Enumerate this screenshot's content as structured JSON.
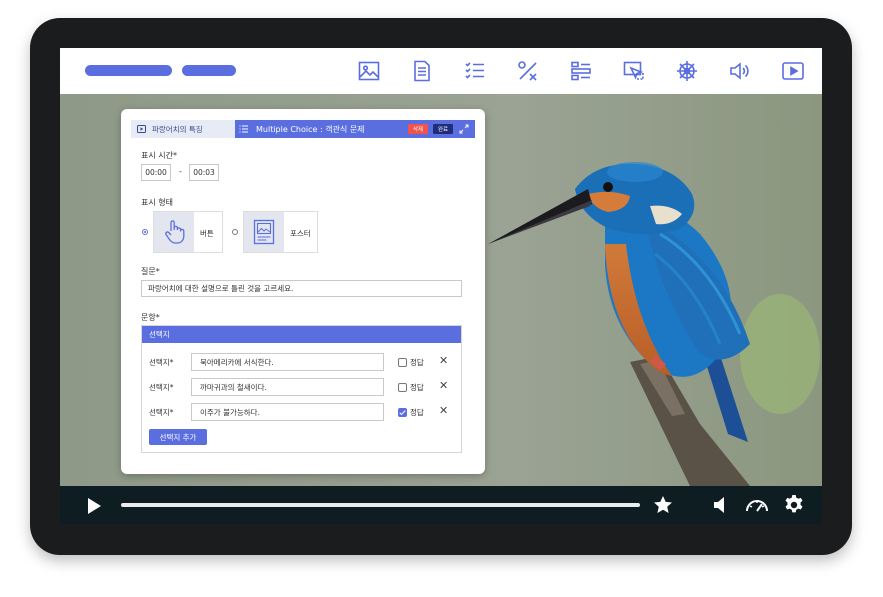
{
  "toolbar": {
    "icons": [
      "image-icon",
      "document-icon",
      "checklist-icon",
      "percent-icon",
      "form-icon",
      "screen-select-icon",
      "helm-icon",
      "volume-icon",
      "play-box-icon"
    ]
  },
  "editor": {
    "tab_video_label": "파랑어치의 특징",
    "tab_question_label": "Multiple Choice : 객관식 문제",
    "delete_label": "삭제",
    "done_label": "완료",
    "time_label": "표시 시간*",
    "time_start": "00:00",
    "time_sep": "-",
    "time_end": "00:03",
    "display_label": "표시 형태",
    "display_options": [
      {
        "label": "버튼",
        "selected": true,
        "icon": "hand-pointer-icon"
      },
      {
        "label": "포스터",
        "selected": false,
        "icon": "poster-icon"
      }
    ],
    "question_label": "질문*",
    "question_text": "파랑어치에 대한 설명으로 틀린 것을 고르세요.",
    "items_label": "문항*",
    "choices_header": "선택지",
    "choice_label": "선택지*",
    "answer_label": "정답",
    "choices": [
      {
        "text": "북아메리카에 서식한다.",
        "correct": false
      },
      {
        "text": "까마귀과의 철새이다.",
        "correct": false
      },
      {
        "text": "이주가 불가능하다.",
        "correct": true
      }
    ],
    "add_choice_label": "선택지 추가"
  },
  "player": {
    "icons": [
      "play-icon",
      "star-icon",
      "volume-icon",
      "speed-gauge-icon",
      "settings-icon"
    ]
  },
  "colors": {
    "accent": "#5a6ee0",
    "control_bar": "#0d1d22",
    "delete_badge": "#f0544f",
    "done_badge": "#1f2e7a"
  }
}
